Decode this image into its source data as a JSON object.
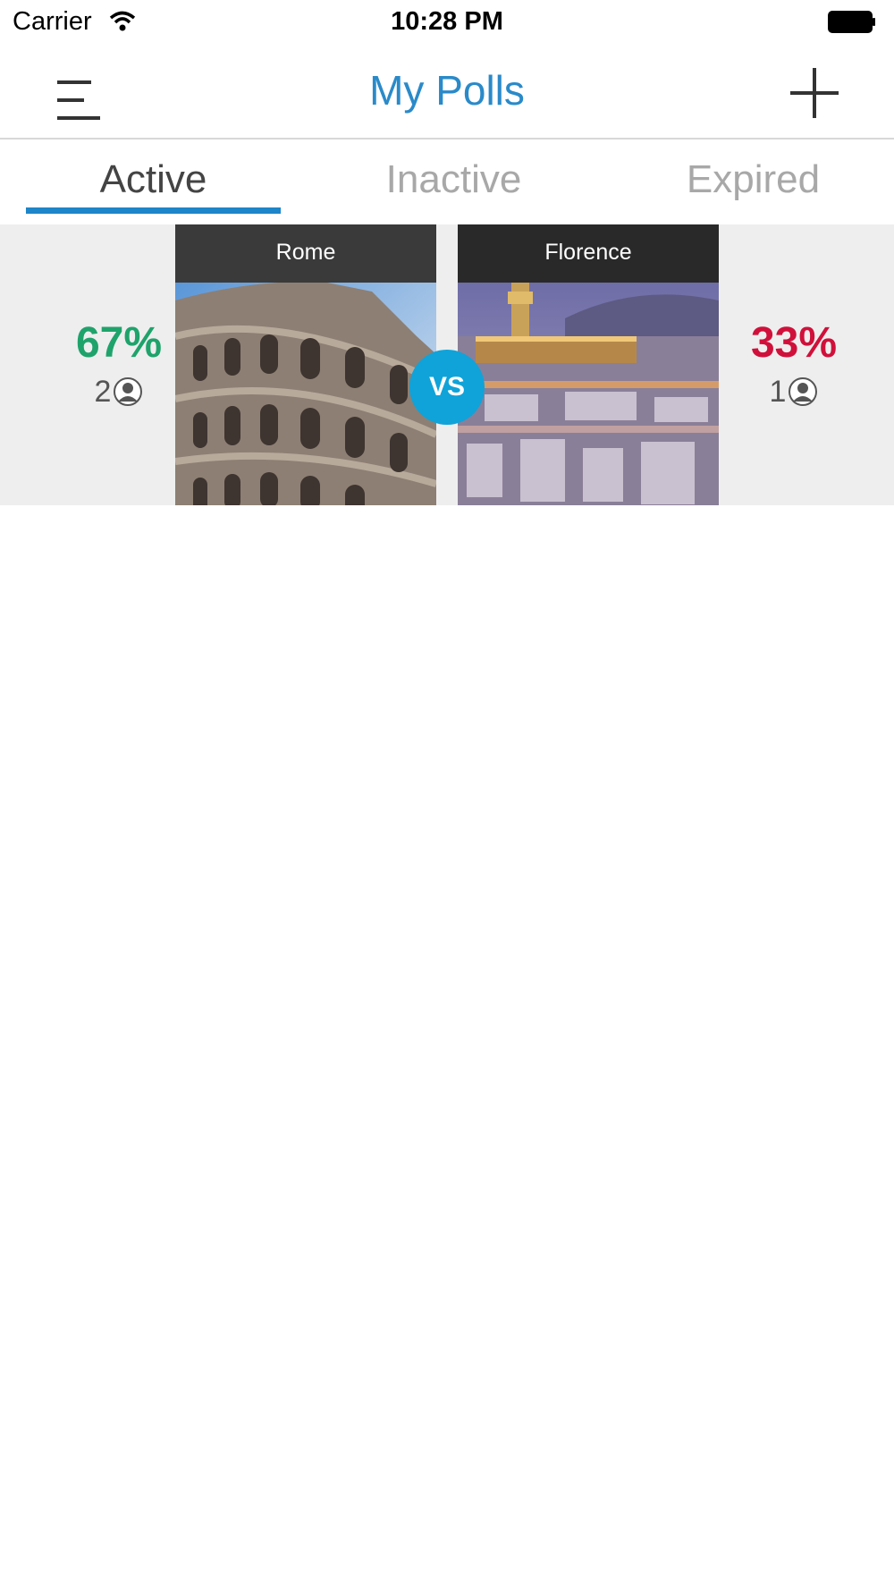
{
  "status_bar": {
    "carrier": "Carrier",
    "time": "10:28 PM"
  },
  "nav": {
    "title": "My Polls"
  },
  "tabs": [
    {
      "label": "Active",
      "selected": true
    },
    {
      "label": "Inactive",
      "selected": false
    },
    {
      "label": "Expired",
      "selected": false
    }
  ],
  "poll": {
    "vs_label": "VS",
    "options": [
      {
        "label": "Rome",
        "percent": "67%",
        "votes": "2",
        "image": "colosseum-photo"
      },
      {
        "label": "Florence",
        "percent": "33%",
        "votes": "1",
        "image": "florence-cityscape-photo"
      }
    ]
  },
  "colors": {
    "accent": "#2a8ac9",
    "tab_underline": "#1d85c8",
    "winner_percent": "#1ea36b",
    "loser_percent": "#d0103a",
    "vs_badge": "#0fa3d9"
  }
}
